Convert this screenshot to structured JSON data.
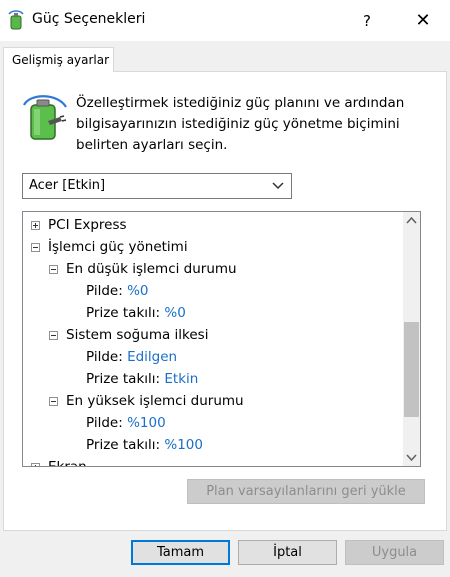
{
  "window": {
    "title": "Güç Seçenekleri",
    "help_glyph": "?",
    "close_glyph": "✕",
    "icon": "power-options-icon"
  },
  "tab": {
    "label": "Gelişmiş ayarlar"
  },
  "description": "Özelleştirmek istediğiniz güç planını ve ardından bilgisayarınızın istediğiniz güç yönetme biçimini belirten ayarları seçin.",
  "plan": {
    "selected": "Acer [Etkin]",
    "icon": "chevron-down-icon"
  },
  "tree": {
    "pci_express": "PCI Express",
    "cpu_power": "İşlemci güç yönetimi",
    "min_state": {
      "label": "En düşük işlemci durumu",
      "battery_label": "Pilde:",
      "battery_value": "%0",
      "plugged_label": "Prize takılı:",
      "plugged_value": "%0"
    },
    "cooling": {
      "label": "Sistem soğuma ilkesi",
      "battery_label": "Pilde:",
      "battery_value": "Edilgen",
      "plugged_label": "Prize takılı:",
      "plugged_value": "Etkin"
    },
    "max_state": {
      "label": "En yüksek işlemci durumu",
      "battery_label": "Pilde:",
      "battery_value": "%100",
      "plugged_label": "Prize takılı:",
      "plugged_value": "%100"
    },
    "display": "Ekran"
  },
  "buttons": {
    "restore": "Plan varsayılanlarını geri yükle",
    "ok": "Tamam",
    "cancel": "İptal",
    "apply": "Uygula"
  },
  "colors": {
    "value_link": "#1a6fc9",
    "default_button_border": "#0078d7"
  }
}
